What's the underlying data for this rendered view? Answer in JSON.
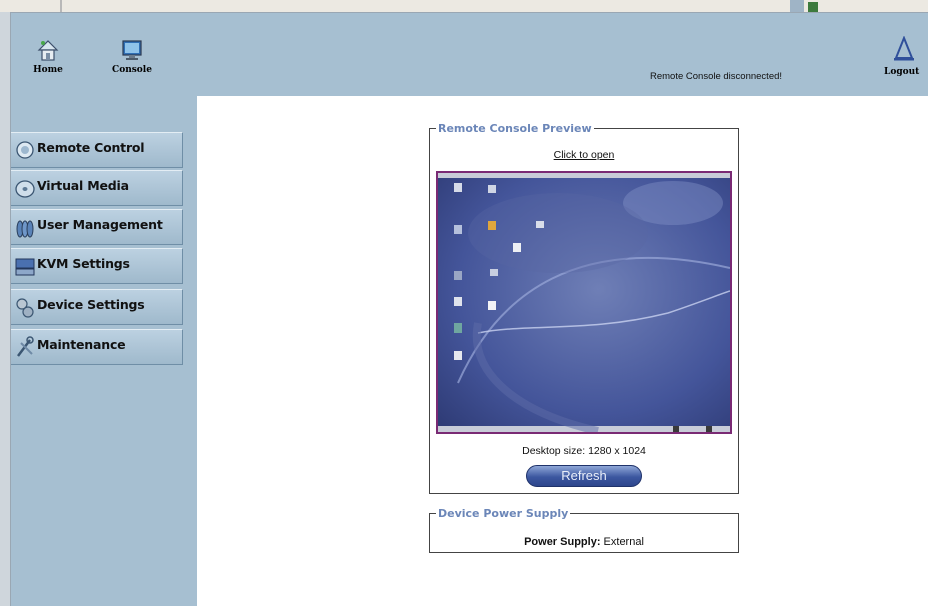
{
  "header": {
    "home_label": "Home",
    "console_label": "Console",
    "status_text": "Remote Console disconnected!",
    "logout_label": "Logout"
  },
  "sidebar": {
    "items": [
      {
        "label": "Remote Control",
        "icon": "monitor-icon"
      },
      {
        "label": "Virtual Media",
        "icon": "disc-icon"
      },
      {
        "label": "User Management",
        "icon": "users-icon"
      },
      {
        "label": "KVM Settings",
        "icon": "keyboard-icon"
      },
      {
        "label": "Device Settings",
        "icon": "gears-icon"
      },
      {
        "label": "Maintenance",
        "icon": "tools-icon"
      }
    ]
  },
  "preview_section": {
    "legend": "Remote Console Preview",
    "click_to_open": "Click to open",
    "desktop_size": "Desktop size: 1280 x 1024",
    "refresh_label": "Refresh"
  },
  "power_section": {
    "legend": "Device Power Supply",
    "label": "Power Supply:",
    "value": "External"
  },
  "colors": {
    "panel_blue": "#a6bfd1",
    "legend_blue": "#6b86b8",
    "preview_border": "#7a2a74",
    "button_blue": "#3c57a0"
  }
}
